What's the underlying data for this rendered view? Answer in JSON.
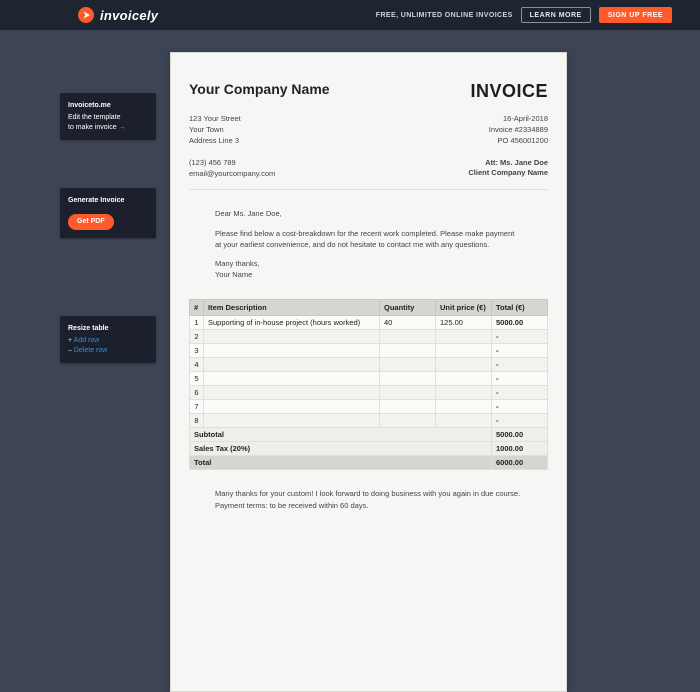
{
  "topbar": {
    "brand": "invoicely",
    "tagline": "FREE, UNLIMITED ONLINE INVOICES",
    "learn_more": "LEARN MORE",
    "signup": "SIGN UP FREE"
  },
  "sidebar": {
    "intro_title": "Invoiceto.me",
    "intro_text_1": "Edit the template",
    "intro_text_2": "to make invoice",
    "intro_arrow": "→",
    "generate_title": "Generate Invoice",
    "getpdf": "Get PDF",
    "resize_title": "Resize table",
    "add_row_glyph": "+",
    "add_row": "Add row",
    "del_row_glyph": "–",
    "del_row": "Delete row"
  },
  "invoice": {
    "company_name": "Your Company Name",
    "title": "INVOICE",
    "address_1": "123 Your Street",
    "address_2": "Your Town",
    "address_3": "Address Line 3",
    "phone": "(123) 456 789",
    "email": "email@yourcompany.com",
    "date": "16-April-2018",
    "number": "Invoice #2334889",
    "po": "PO 456001200",
    "att": "Att: Ms. Jane Doe",
    "client": "Client Company Name",
    "salutation": "Dear Ms. Jane Doe,",
    "intro_para": "Please find below a cost-breakdown for the recent work completed. Please make payment at your earliest convenience, and do not hesitate to contact me with any questions.",
    "thanks_1": "Many thanks,",
    "thanks_2": "Your Name",
    "table": {
      "head_num": "#",
      "head_desc": "Item Description",
      "head_qty": "Quantity",
      "head_price": "Unit price (€)",
      "head_total": "Total (€)",
      "rows": [
        {
          "n": "1",
          "desc": "Supporting of in-house project (hours worked)",
          "qty": "40",
          "price": "125.00",
          "total": "5000.00"
        },
        {
          "n": "2",
          "desc": "",
          "qty": "",
          "price": "",
          "total": "-"
        },
        {
          "n": "3",
          "desc": "",
          "qty": "",
          "price": "",
          "total": "-"
        },
        {
          "n": "4",
          "desc": "",
          "qty": "",
          "price": "",
          "total": "-"
        },
        {
          "n": "5",
          "desc": "",
          "qty": "",
          "price": "",
          "total": "-"
        },
        {
          "n": "6",
          "desc": "",
          "qty": "",
          "price": "",
          "total": "-"
        },
        {
          "n": "7",
          "desc": "",
          "qty": "",
          "price": "",
          "total": "-"
        },
        {
          "n": "8",
          "desc": "",
          "qty": "",
          "price": "",
          "total": "-"
        }
      ],
      "subtotal_label": "Subtotal",
      "subtotal_value": "5000.00",
      "tax_label": "Sales Tax (20%)",
      "tax_value": "1000.00",
      "total_label": "Total",
      "total_value": "6000.00"
    },
    "closing_1": "Many thanks for your custom! I look forward to doing business with you again in due course.",
    "closing_2": "Payment terms: to be received within 60 days."
  }
}
